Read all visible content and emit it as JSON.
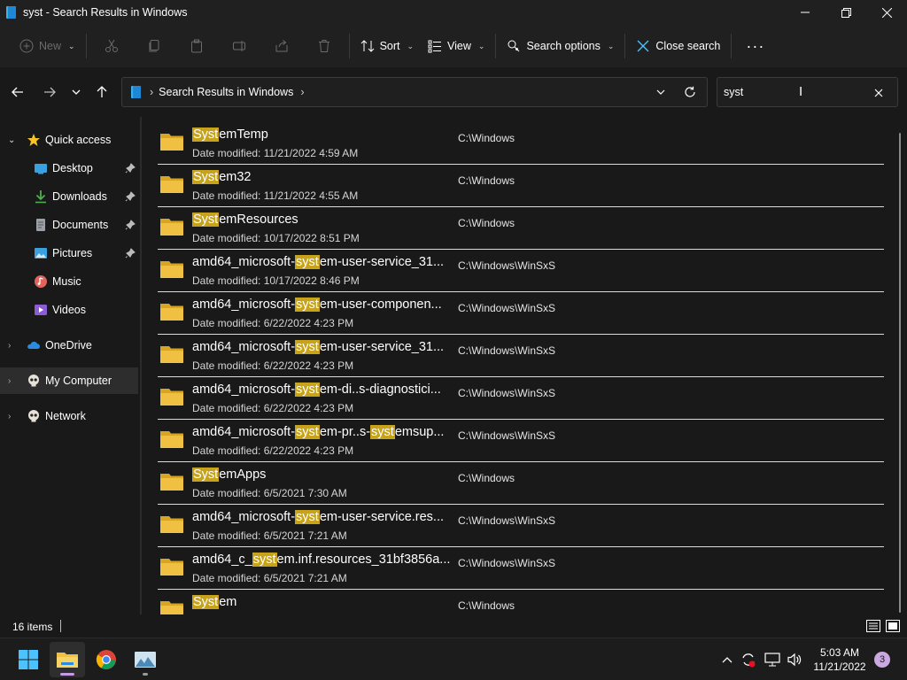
{
  "window": {
    "title": "syst - Search Results in Windows"
  },
  "toolbar": {
    "new_label": "New",
    "sort_label": "Sort",
    "view_label": "View",
    "search_options_label": "Search options",
    "close_search_label": "Close search",
    "more_label": "···"
  },
  "address": {
    "breadcrumb": "Search Results in Windows",
    "separator_left": "›",
    "separator_right": "›"
  },
  "search": {
    "value": "syst"
  },
  "sidebar": {
    "items": [
      {
        "label": "Quick access",
        "icon": "star-icon"
      },
      {
        "label": "Desktop",
        "icon": "desktop-icon",
        "pinned": true
      },
      {
        "label": "Downloads",
        "icon": "download-icon",
        "pinned": true
      },
      {
        "label": "Documents",
        "icon": "documents-icon",
        "pinned": true
      },
      {
        "label": "Pictures",
        "icon": "pictures-icon",
        "pinned": true
      },
      {
        "label": "Music",
        "icon": "music-icon"
      },
      {
        "label": "Videos",
        "icon": "videos-icon"
      },
      {
        "label": "OneDrive",
        "icon": "onedrive-icon"
      },
      {
        "label": "My Computer",
        "icon": "computer-icon",
        "selected": true
      },
      {
        "label": "Network",
        "icon": "network-icon"
      }
    ]
  },
  "results": [
    {
      "name_hl": "Syst",
      "name_pre": "",
      "name_post": "emTemp",
      "date": "Date modified: 11/21/2022 4:59 AM",
      "path": "C:\\Windows"
    },
    {
      "name_hl": "Syst",
      "name_pre": "",
      "name_post": "em32",
      "date": "Date modified: 11/21/2022 4:55 AM",
      "path": "C:\\Windows"
    },
    {
      "name_hl": "Syst",
      "name_pre": "",
      "name_post": "emResources",
      "date": "Date modified: 10/17/2022 8:51 PM",
      "path": "C:\\Windows"
    },
    {
      "name_hl": "syst",
      "name_pre": "amd64_microsoft-",
      "name_post": "em-user-service_31...",
      "date": "Date modified: 10/17/2022 8:46 PM",
      "path": "C:\\Windows\\WinSxS"
    },
    {
      "name_hl": "syst",
      "name_pre": "amd64_microsoft-",
      "name_post": "em-user-componen...",
      "date": "Date modified: 6/22/2022 4:23 PM",
      "path": "C:\\Windows\\WinSxS"
    },
    {
      "name_hl": "syst",
      "name_pre": "amd64_microsoft-",
      "name_post": "em-user-service_31...",
      "date": "Date modified: 6/22/2022 4:23 PM",
      "path": "C:\\Windows\\WinSxS"
    },
    {
      "name_hl": "syst",
      "name_pre": "amd64_microsoft-",
      "name_post": "em-di..s-diagnostici...",
      "date": "Date modified: 6/22/2022 4:23 PM",
      "path": "C:\\Windows\\WinSxS"
    },
    {
      "name_hl": "syst",
      "name_pre": "amd64_microsoft-",
      "name_post": "em-pr..s-",
      "name_hl2": "syst",
      "name_post2": "emsup...",
      "date": "Date modified: 6/22/2022 4:23 PM",
      "path": "C:\\Windows\\WinSxS"
    },
    {
      "name_hl": "Syst",
      "name_pre": "",
      "name_post": "emApps",
      "date": "Date modified: 6/5/2021 7:30 AM",
      "path": "C:\\Windows"
    },
    {
      "name_hl": "syst",
      "name_pre": "amd64_microsoft-",
      "name_post": "em-user-service.res...",
      "date": "Date modified: 6/5/2021 7:21 AM",
      "path": "C:\\Windows\\WinSxS"
    },
    {
      "name_hl": "syst",
      "name_pre": "amd64_c_",
      "name_post": "em.inf.resources_31bf3856a...",
      "date": "Date modified: 6/5/2021 7:21 AM",
      "path": "C:\\Windows\\WinSxS"
    },
    {
      "name_hl": "Syst",
      "name_pre": "",
      "name_post": "em",
      "date": "",
      "path": "C:\\Windows"
    }
  ],
  "status": {
    "item_count": "16 items"
  },
  "taskbar": {
    "time": "5:03 AM",
    "date": "11/21/2022",
    "notifications": "3"
  },
  "colors": {
    "highlight": "#c7a31c",
    "folder": "#f0c043",
    "accent": "#4cc2ff"
  }
}
